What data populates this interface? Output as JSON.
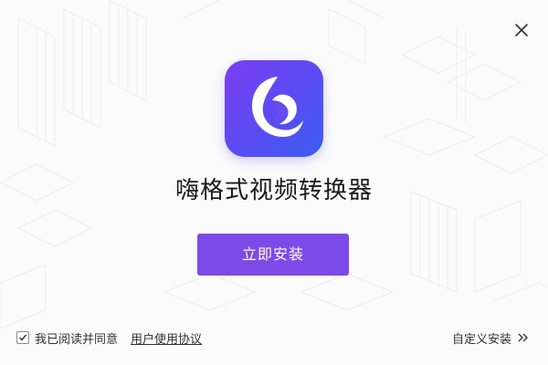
{
  "app": {
    "title": "嗨格式视频转换器",
    "icon": "app-logo-icon",
    "accent_color": "#7c4be7"
  },
  "actions": {
    "install_label": "立即安装",
    "custom_install_label": "自定义安装"
  },
  "agreement": {
    "checked": true,
    "text": "我已阅读并同意",
    "link_label": "用户使用协议"
  },
  "window": {
    "close_icon": "close-icon"
  }
}
